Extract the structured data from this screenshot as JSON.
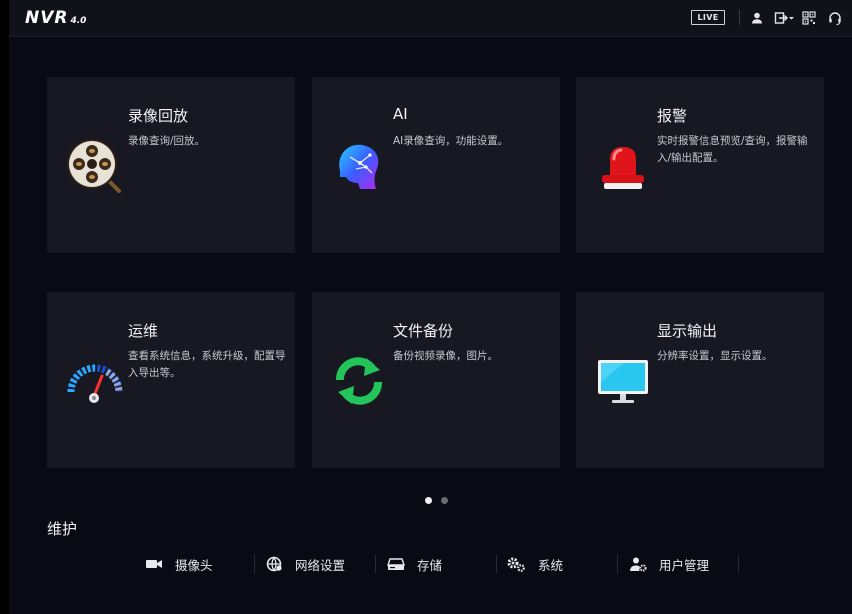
{
  "header": {
    "logo_text": "NVR",
    "logo_version": "4.0",
    "live_label": "LIVE",
    "icons": [
      "user-icon",
      "logout-icon",
      "qrcode-icon",
      "headset-icon"
    ]
  },
  "cards": [
    {
      "title": "录像回放",
      "desc": "录像查询/回放。",
      "icon": "film-reel-icon"
    },
    {
      "title": "AI",
      "desc": "AI录像查询，功能设置。",
      "icon": "ai-head-icon"
    },
    {
      "title": "报警",
      "desc": "实时报警信息预览/查询，报警输入/输出配置。",
      "icon": "alarm-light-icon"
    },
    {
      "title": "运维",
      "desc": "查看系统信息，系统升级，配置导入导出等。",
      "icon": "gauge-icon"
    },
    {
      "title": "文件备份",
      "desc": "备份视频录像，图片。",
      "icon": "refresh-icon"
    },
    {
      "title": "显示输出",
      "desc": "分辨率设置，显示设置。",
      "icon": "monitor-icon"
    }
  ],
  "pagination": {
    "current": 1,
    "total": 2
  },
  "maintenance": {
    "title": "维护",
    "items": [
      {
        "label": "摄像头",
        "icon": "camera-icon"
      },
      {
        "label": "网络设置",
        "icon": "network-icon"
      },
      {
        "label": "存储",
        "icon": "storage-icon"
      },
      {
        "label": "系统",
        "icon": "gears-icon"
      },
      {
        "label": "用户管理",
        "icon": "user-gear-icon"
      }
    ]
  },
  "colors": {
    "background": "#0a0a14",
    "card": "#171821",
    "accent_red": "#e0151b",
    "accent_green": "#2ecc40",
    "accent_cyan": "#29c6f0"
  }
}
